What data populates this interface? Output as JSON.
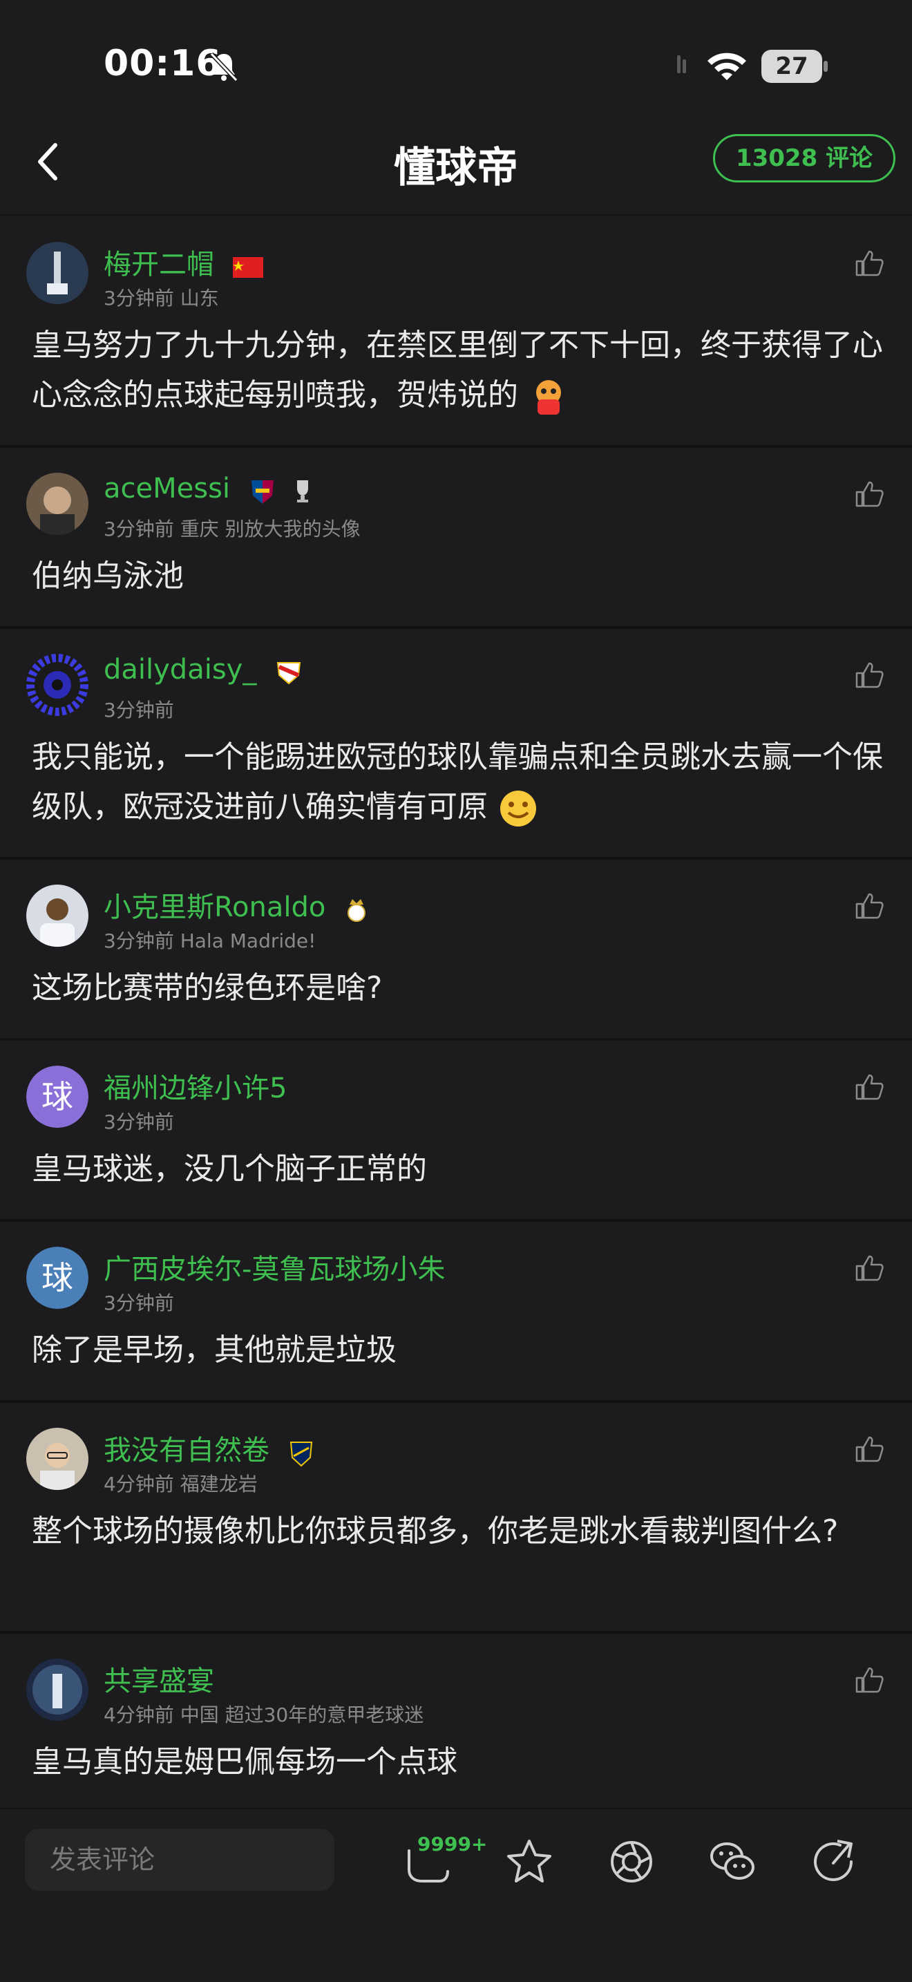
{
  "status_bar": {
    "time": "00:16",
    "battery": "27"
  },
  "nav": {
    "title": "懂球帝",
    "comment_count": "13028 评论"
  },
  "comments": [
    {
      "username": "梅开二帽",
      "meta": "3分钟前 山东",
      "text": "皇马努力了九十九分钟，在禁区里倒了不下十回，终于获得了心心念念的点球起每别喷我，贺炜说的",
      "avatar_color": "#2a3a50"
    },
    {
      "username": "aceMessi",
      "meta": "3分钟前 重庆 别放大我的头像",
      "text": "伯纳乌泳池",
      "avatar_color": "#6b5a48"
    },
    {
      "username": "dailydaisy_",
      "meta": "3分钟前",
      "text": "我只能说，一个能踢进欧冠的球队靠骗点和全员跳水去赢一个保级队，欧冠没进前八确实情有可原",
      "avatar_color": "#2b2bb8"
    },
    {
      "username": "小克里斯Ronaldo",
      "meta": "3分钟前 Hala Madride!",
      "text": "这场比赛带的绿色环是啥?",
      "avatar_color": "#d8dde5"
    },
    {
      "username": "福州边锋小许5",
      "meta": "3分钟前",
      "text": "皇马球迷，没几个脑子正常的",
      "avatar_letter": "球",
      "avatar_color": "#8a6fd8"
    },
    {
      "username": "广西皮埃尔-莫鲁瓦球场小朱",
      "meta": "3分钟前",
      "text": "除了是早场，其他就是垃圾",
      "avatar_letter": "球",
      "avatar_color": "#4a7fb8"
    },
    {
      "username": "我没有自然卷",
      "meta": "4分钟前 福建龙岩",
      "text": "整个球场的摄像机比你球员都多，你老是跳水看裁判图什么?",
      "avatar_color": "#c9c0b0"
    },
    {
      "username": "共享盛宴",
      "meta": "4分钟前 中国 超过30年的意甲老球迷",
      "text": "皇马真的是姆巴佩每场一个点球",
      "avatar_color": "#1e2a44"
    }
  ],
  "bottom_bar": {
    "input_placeholder": "发表评论",
    "reply_count": "9999+"
  },
  "colors": {
    "accent": "#3fbf4f",
    "background": "#1c1c1e",
    "divider": "#111111"
  },
  "icons": [
    "chevron-left-icon",
    "thumb-up-icon",
    "reply-icon",
    "star-icon",
    "share-circle-icon",
    "wechat-icon",
    "forward-icon",
    "bell-slash-icon",
    "wifi-icon",
    "battery-icon"
  ]
}
